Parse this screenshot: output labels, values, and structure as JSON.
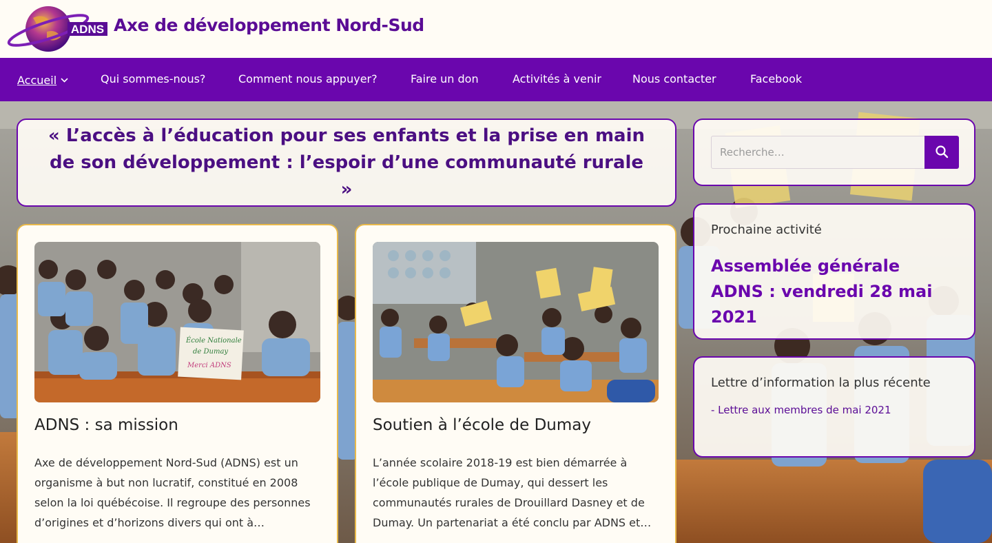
{
  "header": {
    "logo_text": "ADNS",
    "site_title": "Axe de développement Nord-Sud"
  },
  "nav": {
    "items": [
      {
        "label": "Accueil",
        "active": true
      },
      {
        "label": "Qui sommes-nous?"
      },
      {
        "label": "Comment nous appuyer?"
      },
      {
        "label": "Faire un don"
      },
      {
        "label": "Activités à venir"
      },
      {
        "label": "Nous contacter"
      },
      {
        "label": "Facebook"
      }
    ]
  },
  "tagline": "« L’accès à l’éducation pour ses enfants et la prise en main de son développement : l’espoir d’une communauté rurale »",
  "sidebar": {
    "search": {
      "placeholder": "Recherche…"
    },
    "activity": {
      "heading": "Prochaine activité",
      "title": "Assemblée générale ADNS : vendredi 28 mai 2021"
    },
    "newsletter": {
      "heading": "Lettre d’information la plus récente",
      "link": "- Lettre aux membres de mai 2021"
    }
  },
  "posts": [
    {
      "title": "ADNS : sa mission",
      "excerpt": "Axe de développement Nord-Sud (ADNS) est un organisme à but non lucratif, constitué en 2008 selon la loi québécoise. Il regroupe des personnes d’origines et d’horizons divers qui ont à…",
      "sign_lines": [
        "École Nationale",
        "de Dumay",
        "Merci ADNS"
      ]
    },
    {
      "title": "Soutien à l’école de Dumay",
      "excerpt": "L’année scolaire 2018-19 est bien démarrée à l’école publique de Dumay, qui dessert les communautés rurales de Drouillard Dasney et de Dumay. Un partenariat a été conclu par ADNS et…"
    }
  ],
  "colors": {
    "brand_purple": "#6a06ad",
    "card_border": "#e8b94a",
    "background": "#fffcf5"
  }
}
